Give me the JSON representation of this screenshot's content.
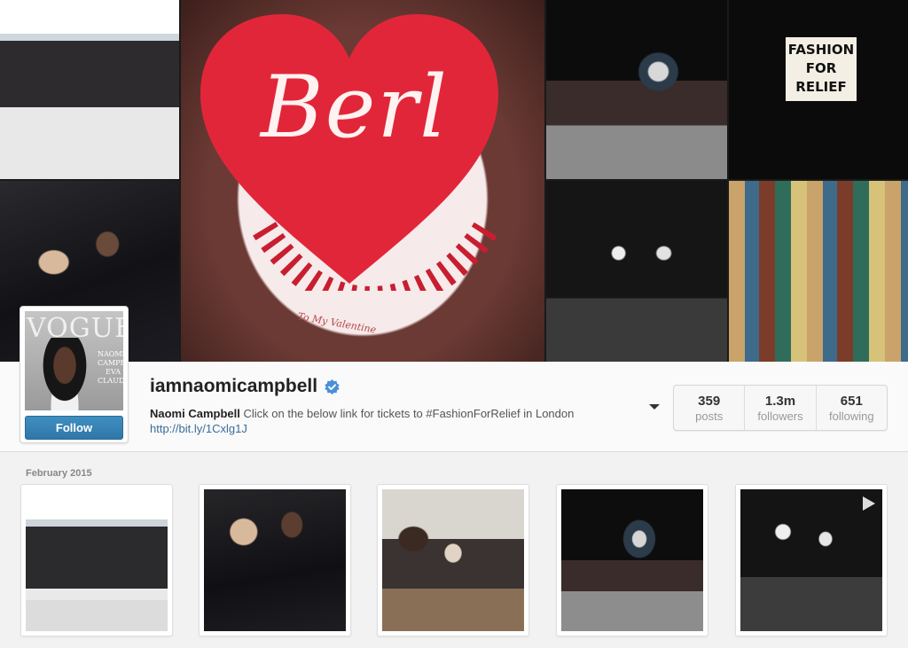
{
  "cover": {
    "cake_script": "Berl",
    "cake_ribbon": "To My Valentine",
    "sign_lines": [
      "FASHION",
      "FOR",
      "RELIEF"
    ]
  },
  "avatar": {
    "magazine_title": "VOGUE",
    "cover_names": "NAOMI CAMPBELL EVA CLAUDIA"
  },
  "profile": {
    "username": "iamnaomicampbell",
    "verified": true,
    "full_name": "Naomi Campbell",
    "bio": "Click on the below link for tickets to #FashionForRelief in London",
    "link": "http://bit.ly/1Cxlg1J",
    "follow_label": "Follow"
  },
  "stats": [
    {
      "value": "359",
      "label": "posts"
    },
    {
      "value": "1.3m",
      "label": "followers"
    },
    {
      "value": "651",
      "label": "following"
    }
  ],
  "feed": {
    "month_label": "February 2015"
  },
  "colors": {
    "follow_button": "#3a85b8",
    "link": "#3a6d99",
    "verified_badge": "#4a90d9",
    "heart": "#e2263a"
  }
}
